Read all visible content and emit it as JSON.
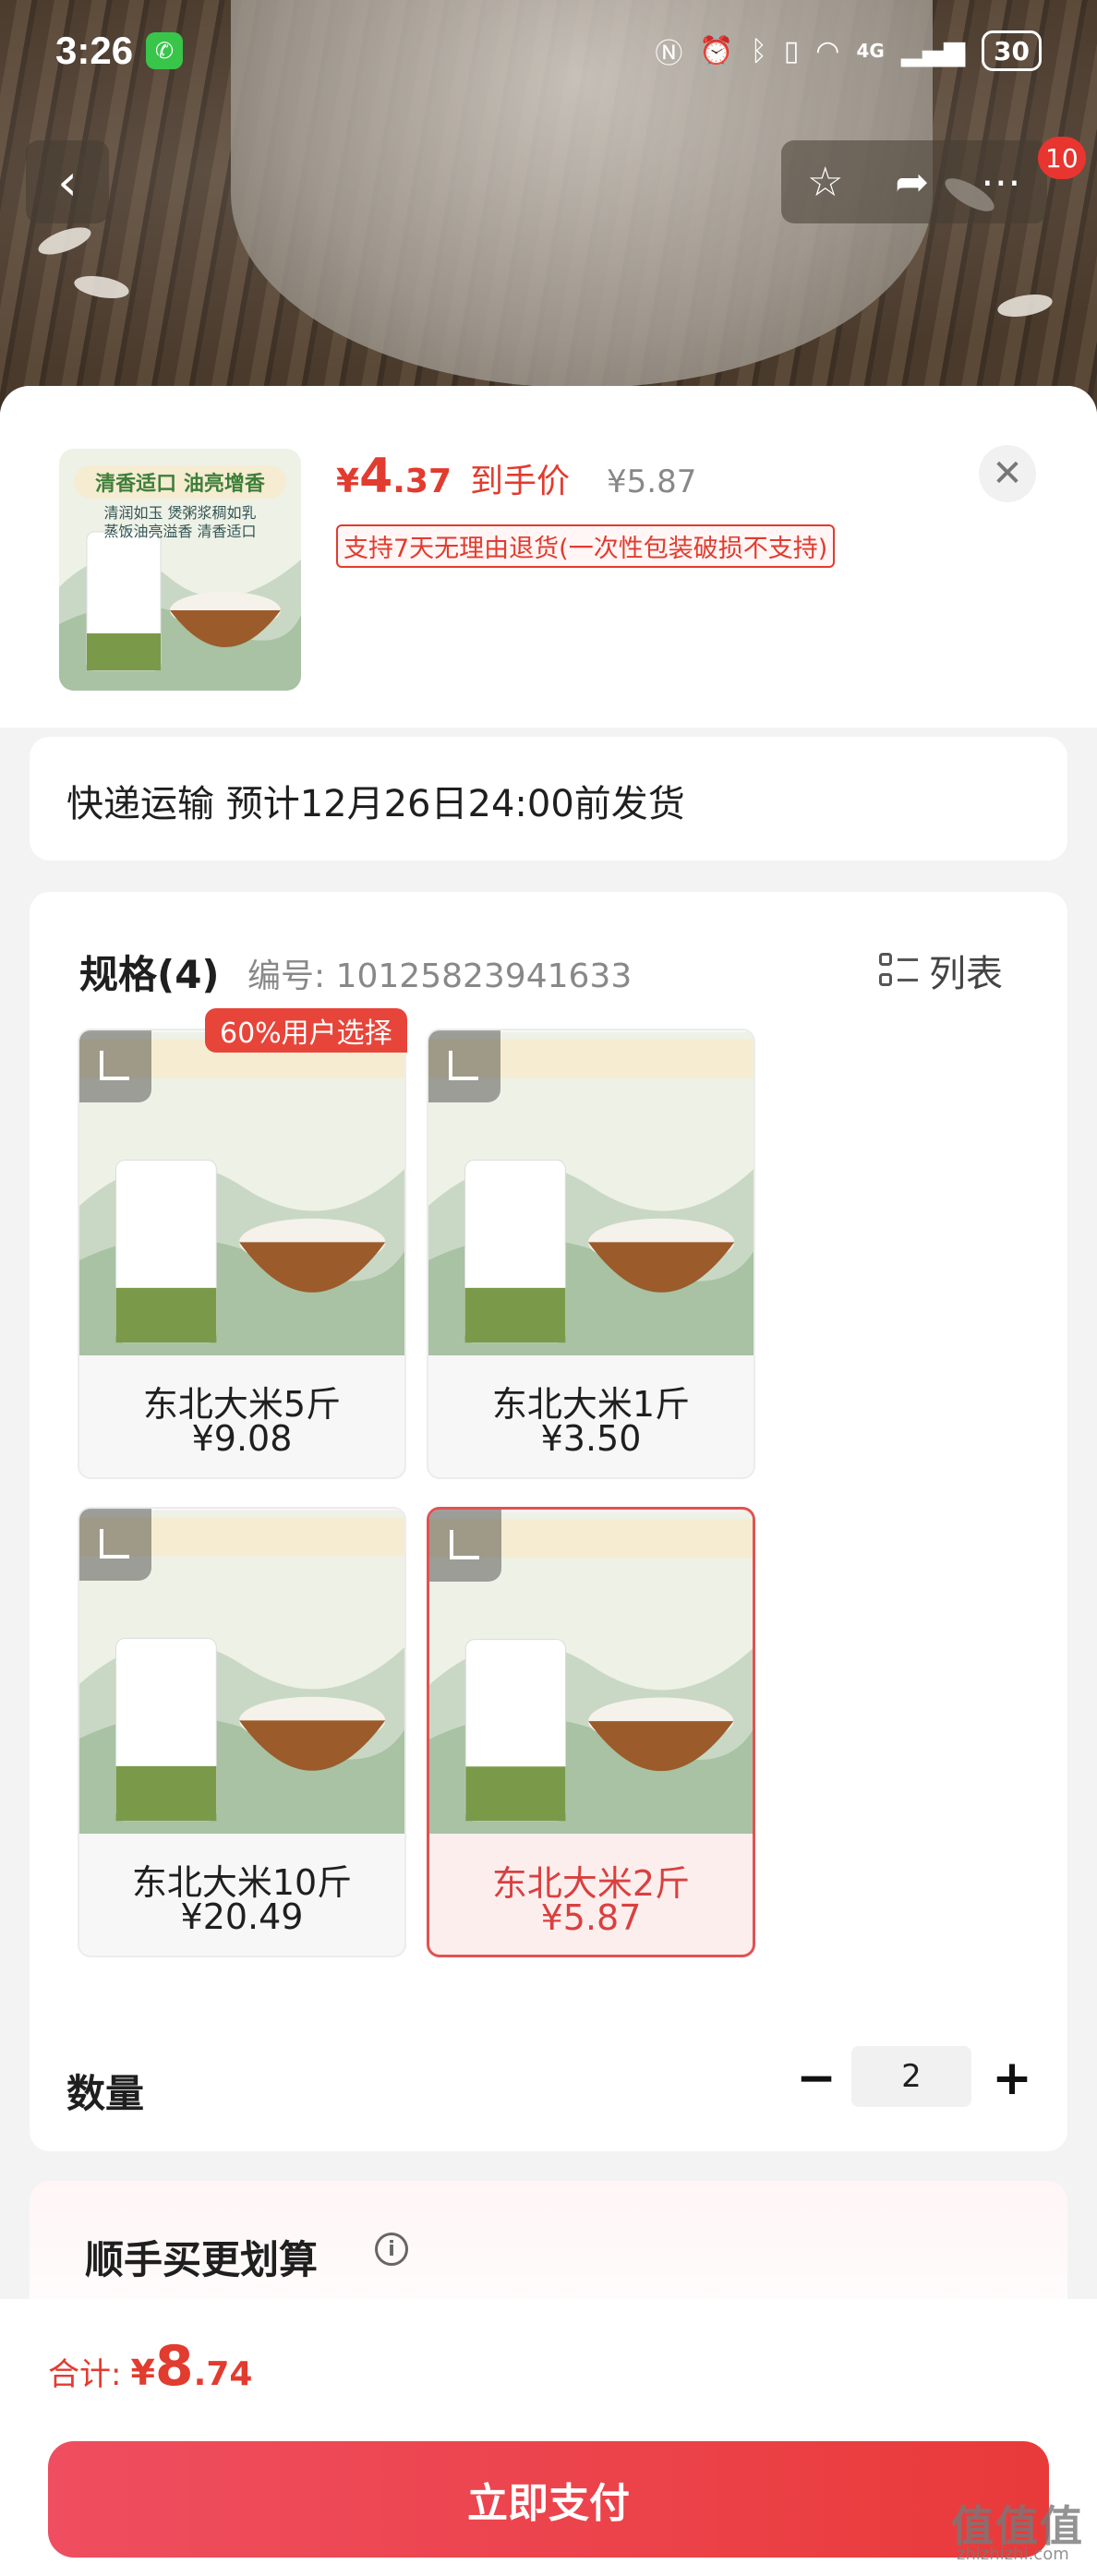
{
  "status_bar": {
    "time": "3:26",
    "battery": "30",
    "network": "4G"
  },
  "nav": {
    "badge_count": "10"
  },
  "product": {
    "yen_symbol": "¥",
    "price_int": "4",
    "price_dec": ".37",
    "price_label": "到手价",
    "original_price": "¥5.87",
    "return_policy": "支持7天无理由退货(一次性包装破损不支持)",
    "thumb_slogan": "清香适口 油亮增香",
    "thumb_lines": [
      "清润如玉 煲粥浆稠如乳",
      "蒸饭油亮溢香 清香适口"
    ]
  },
  "shipping": {
    "text": "快递运输 预计12月26日24:00前发货"
  },
  "spec": {
    "title": "规格(4)",
    "code": "编号: 10125823941633",
    "list_label": "列表",
    "popular_tag": "60%用户选择",
    "variants": [
      {
        "name": "东北大米5斤",
        "price": "¥9.08",
        "selected": false
      },
      {
        "name": "东北大米1斤",
        "price": "¥3.50",
        "selected": false
      },
      {
        "name": "东北大米10斤",
        "price": "¥20.49",
        "selected": false
      },
      {
        "name": "东北大米2斤",
        "price": "¥5.87",
        "selected": true
      }
    ]
  },
  "quantity": {
    "label": "数量",
    "minus": "−",
    "value": "2",
    "plus": "+"
  },
  "bundle": {
    "title": "顺手买更划算",
    "info": "i"
  },
  "footer": {
    "total_label": "合计:",
    "total_yen": "¥",
    "total_int": "8",
    "total_dec": ".74",
    "pay_label": "立即支付"
  },
  "watermark": {
    "main": "值值值",
    "sub": "zhizhizhi.com"
  },
  "colors": {
    "accent": "#e23b2f",
    "pay_button": "#ec4150",
    "selected_border": "#e05353"
  }
}
